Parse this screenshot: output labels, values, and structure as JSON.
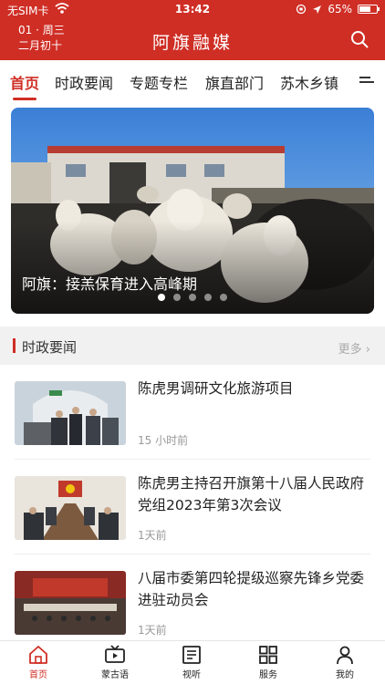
{
  "status_bar": {
    "carrier": "无SIM卡",
    "time": "13:42",
    "battery": "65%",
    "battery_level": 0.65
  },
  "header": {
    "date_line1": "01 · 周三",
    "date_line2": "二月初十",
    "app_title": "阿旗融媒",
    "icon": "search-icon"
  },
  "tabs": [
    {
      "label": "首页",
      "active": true
    },
    {
      "label": "时政要闻"
    },
    {
      "label": "专题专栏"
    },
    {
      "label": "旗直部门"
    },
    {
      "label": "苏木乡镇"
    }
  ],
  "banner": {
    "caption": "阿旗：接羔保育进入高峰期",
    "slide_count": 5,
    "active_slide": 1
  },
  "section": {
    "title": "时政要闻",
    "more": "更多"
  },
  "news": [
    {
      "title": "陈虎男调研文化旅游项目",
      "time": "15 小时前"
    },
    {
      "title": "陈虎男主持召开旗第十八届人民政府党组2023年第3次会议",
      "time": "1天前"
    },
    {
      "title": "八届市委第四轮提级巡察先锋乡党委进驻动员会",
      "time": "1天前"
    }
  ],
  "bottom_nav": [
    {
      "label": "首页",
      "icon": "home-icon",
      "active": true
    },
    {
      "label": "蒙古语",
      "icon": "tv-icon"
    },
    {
      "label": "视听",
      "icon": "newspaper-icon"
    },
    {
      "label": "服务",
      "icon": "grid-icon"
    },
    {
      "label": "我的",
      "icon": "user-icon"
    }
  ],
  "colors": {
    "brand": "#cf2e25",
    "muted": "#999999"
  }
}
